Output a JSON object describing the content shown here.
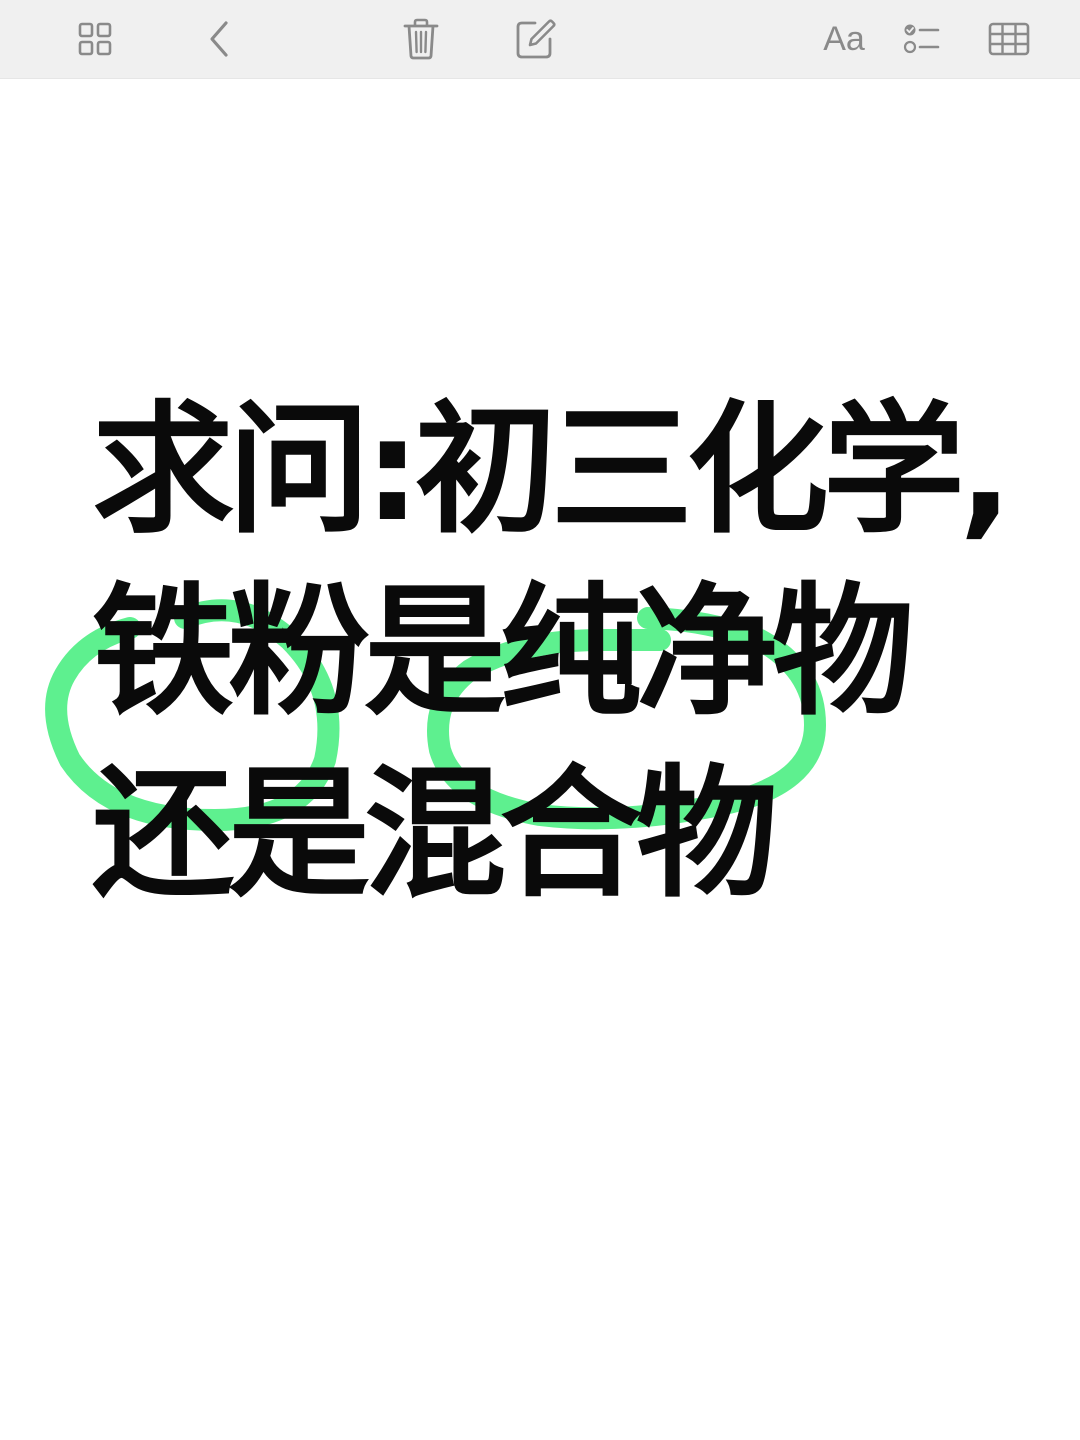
{
  "toolbar": {
    "buttons": [
      {
        "name": "gallery-view",
        "icon": "grid-icon"
      },
      {
        "name": "back",
        "icon": "chevron-left-icon"
      },
      {
        "name": "delete",
        "icon": "trash-icon"
      },
      {
        "name": "compose",
        "icon": "compose-icon"
      },
      {
        "name": "format",
        "icon": "text-format-icon",
        "label": "Aa"
      },
      {
        "name": "checklist",
        "icon": "checklist-icon"
      },
      {
        "name": "table",
        "icon": "table-icon"
      }
    ],
    "icon_color": "#8a8a8a",
    "background": "#f0f0f0"
  },
  "note": {
    "lines": [
      "求问:初三化学,",
      "铁粉是纯净物",
      "还是混合物"
    ],
    "text_color": "#0a0a0a",
    "highlight_color": "#5ef08f"
  }
}
